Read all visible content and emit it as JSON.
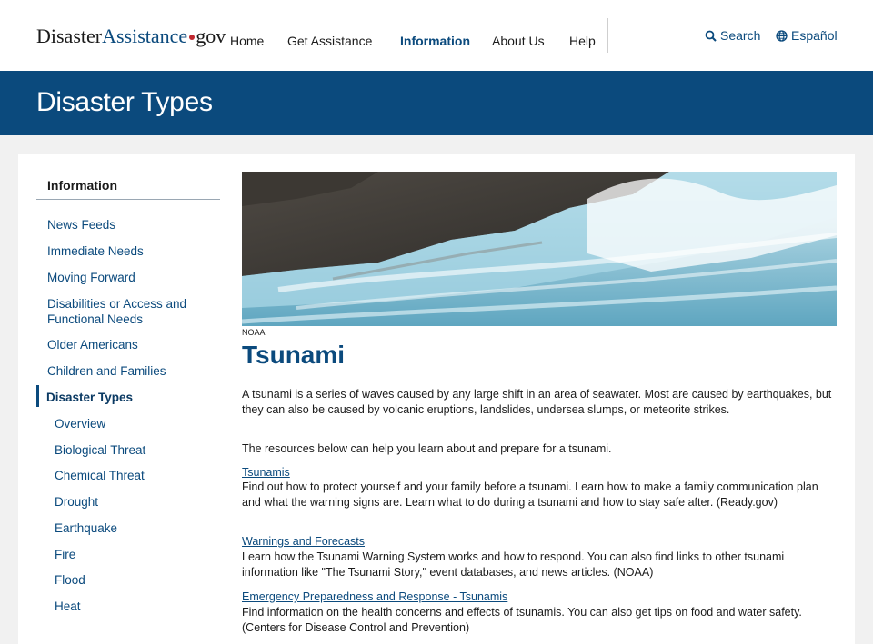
{
  "header": {
    "logo": {
      "part1": "Disaster",
      "part2": "Assistance",
      "part3": "gov"
    },
    "nav": [
      "Home",
      "Get Assistance",
      "Information",
      "About Us",
      "Help"
    ],
    "search_label": "Search",
    "language_label": "Español"
  },
  "banner": {
    "title": "Disaster Types"
  },
  "sidebar": {
    "title": "Information",
    "items": [
      "News Feeds",
      "Immediate Needs",
      "Moving Forward",
      "Disabilities or Access and Functional Needs",
      "Older Americans",
      "Children and Families",
      "Disaster Types"
    ],
    "subitems": [
      "Overview",
      "Biological Threat",
      "Chemical Threat",
      "Drought",
      "Earthquake",
      "Fire",
      "Flood",
      "Heat"
    ]
  },
  "main": {
    "image_caption": "NOAA",
    "title": "Tsunami",
    "intro": "A tsunami is a series of waves caused by any large shift in an area of seawater. Most are caused by earthquakes, but they can also be caused by volcanic eruptions, landslides, undersea slumps, or meteorite strikes.",
    "resources_intro": "The resources below can help you learn about and prepare for a tsunami.",
    "resources": [
      {
        "title": "Tsunamis",
        "description": "Find out how to protect yourself and your family before a tsunami. Learn how to make a family communication plan and what the warning signs are. Learn what to do during a tsunami and how to stay safe after. (Ready.gov)"
      },
      {
        "title": "Warnings and Forecasts",
        "description": "Learn how the Tsunami Warning System works and how to respond. You can also find links to other tsunami information like \"The Tsunami Story,\" event databases, and news articles. (NOAA)"
      },
      {
        "title": "Emergency Preparedness and Response - Tsunamis",
        "description": "Find information on the health concerns and effects of tsunamis. You can also get tips on food and water safety. (Centers for Disease Control and Prevention)"
      }
    ]
  },
  "colors": {
    "brand_blue": "#0b4a7d",
    "logo_dot": "#c0262e",
    "page_bg": "#f1f1f1"
  }
}
